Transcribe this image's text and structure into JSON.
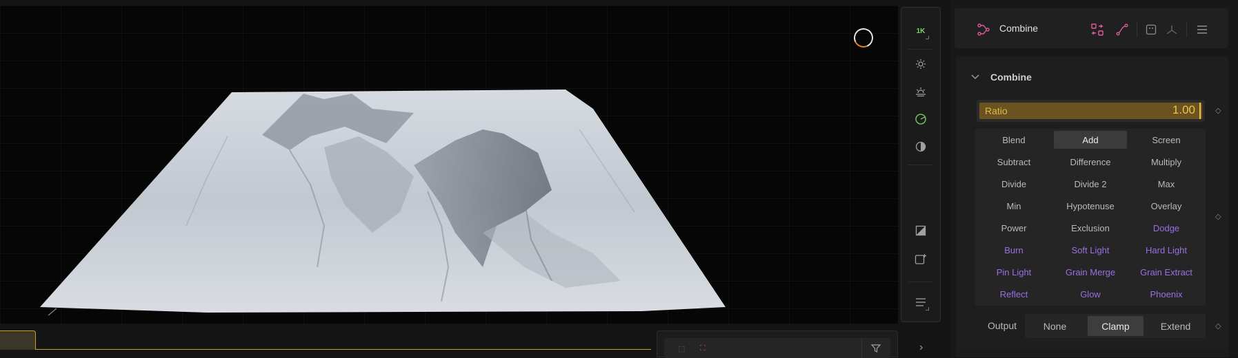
{
  "viewport": {
    "resolution_label": "1K",
    "toolbar_icons": [
      "sun-icon",
      "sunrise-icon",
      "environment-icon",
      "contrast-icon",
      "compare-icon",
      "add-frame-icon",
      "list-menu-icon"
    ]
  },
  "bottom": {
    "right_chevron": "›",
    "filter_icon": "filter-icon"
  },
  "node": {
    "title": "Combine",
    "icon": "node-graph-icon",
    "header_buttons": [
      "swap-icon",
      "curve-icon",
      "grid-icon",
      "axis-icon",
      "menu-icon"
    ]
  },
  "section": {
    "title": "Combine"
  },
  "ratio": {
    "label": "Ratio",
    "value": "1.00"
  },
  "modes": [
    {
      "label": "Blend"
    },
    {
      "label": "Add",
      "selected": true
    },
    {
      "label": "Screen"
    },
    {
      "label": "Subtract"
    },
    {
      "label": "Difference"
    },
    {
      "label": "Multiply"
    },
    {
      "label": "Divide"
    },
    {
      "label": "Divide 2"
    },
    {
      "label": "Max"
    },
    {
      "label": "Min"
    },
    {
      "label": "Hypotenuse"
    },
    {
      "label": "Overlay"
    },
    {
      "label": "Power"
    },
    {
      "label": "Exclusion"
    },
    {
      "label": "Dodge",
      "purple": true
    },
    {
      "label": "Burn",
      "purple": true
    },
    {
      "label": "Soft Light",
      "purple": true
    },
    {
      "label": "Hard Light",
      "purple": true
    },
    {
      "label": "Pin Light",
      "purple": true
    },
    {
      "label": "Grain Merge",
      "purple": true
    },
    {
      "label": "Grain Extract",
      "purple": true
    },
    {
      "label": "Reflect",
      "purple": true
    },
    {
      "label": "Glow",
      "purple": true
    },
    {
      "label": "Phoenix",
      "purple": true
    }
  ],
  "output": {
    "label": "Output",
    "options": [
      {
        "label": "None"
      },
      {
        "label": "Clamp",
        "selected": true
      },
      {
        "label": "Extend"
      }
    ]
  },
  "colors": {
    "accent_gold": "#f2c24b",
    "advanced_mode_purple": "#9a6fe0",
    "node_icon_pink": "#e05aa0",
    "resolution_green": "#7fd16b"
  }
}
